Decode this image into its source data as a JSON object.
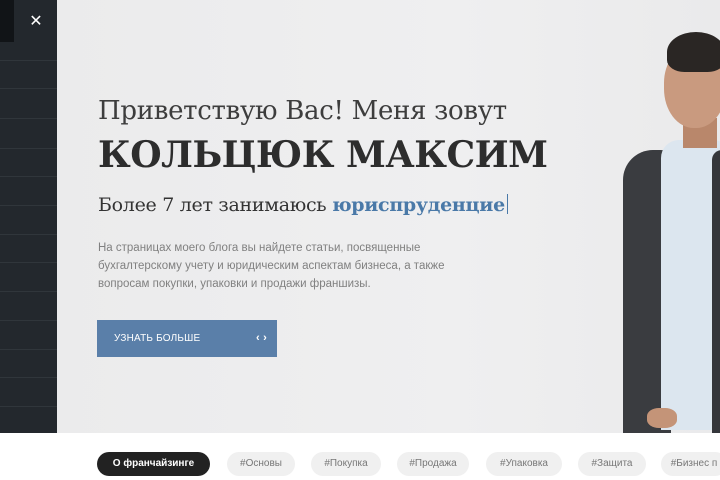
{
  "sidebar": {
    "close_label": "✕"
  },
  "hero": {
    "greeting": "Приветствую Вас! Меня зовут",
    "name": "КОЛЬЦЮК МАКСИМ",
    "experience_prefix": "Более 7 лет занимаюсь ",
    "experience_highlight": "юриспруденцие",
    "description": "На страницах моего блога вы найдете статьи, посвященные бухгалтерскому учету и юридическим аспектам бизнеса, а также вопросам покупки, упаковки и продажи франшизы.",
    "cta_label": "УЗНАТЬ БОЛЬШЕ",
    "cta_icon": "‹ ›",
    "accent_color": "#5a7fa9"
  },
  "tags": [
    {
      "label": "О франчайзинге",
      "active": true
    },
    {
      "label": "#Основы",
      "active": false
    },
    {
      "label": "#Покупка",
      "active": false
    },
    {
      "label": "#Продажа",
      "active": false
    },
    {
      "label": "#Упаковка",
      "active": false
    },
    {
      "label": "#Защита",
      "active": false
    },
    {
      "label": "#Бизнес п",
      "active": false
    }
  ]
}
